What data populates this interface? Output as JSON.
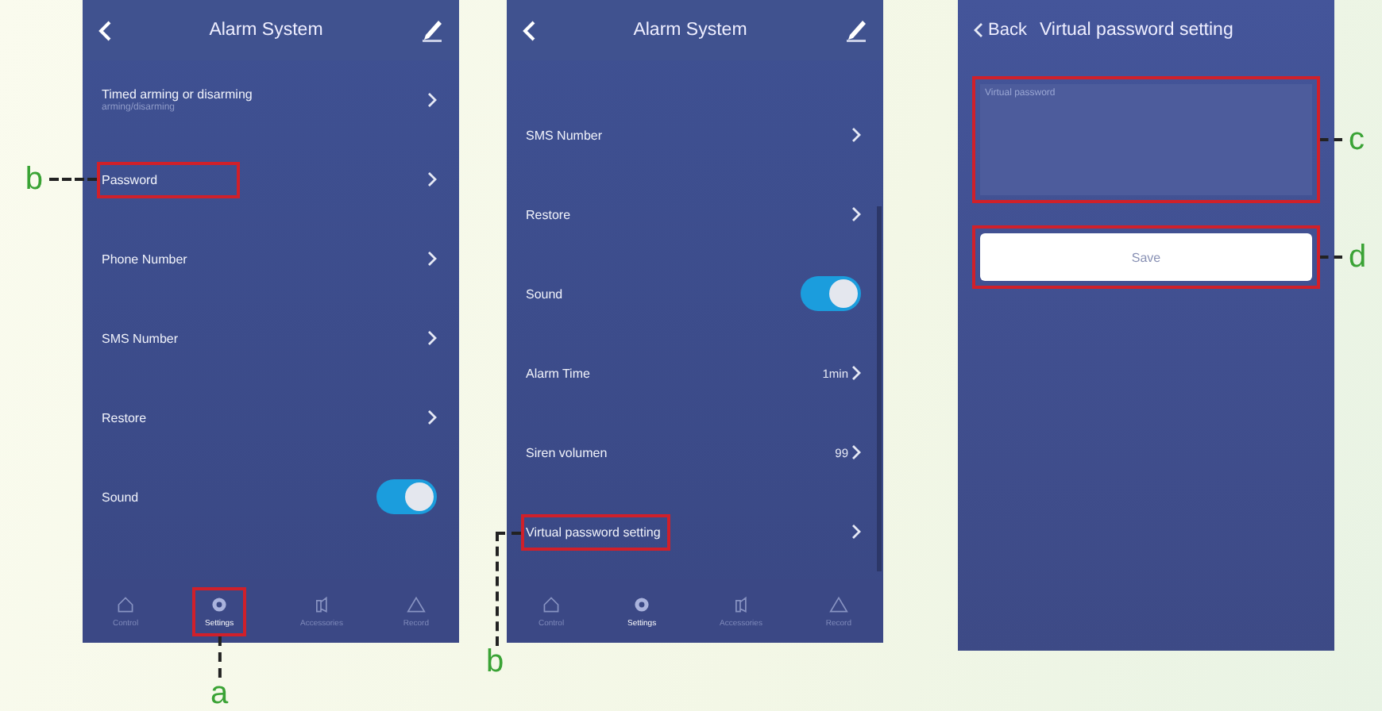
{
  "screens": [
    {
      "kind": "settings",
      "title": "Alarm System",
      "scrolled": false,
      "rows": [
        {
          "kind": "link",
          "label": "Timed arming or disarming",
          "sublabel": "arming/disarming"
        },
        {
          "kind": "link",
          "label": "Password",
          "callout": "b"
        },
        {
          "kind": "link",
          "label": "Phone Number"
        },
        {
          "kind": "link",
          "label": "SMS Number"
        },
        {
          "kind": "link",
          "label": "Restore"
        },
        {
          "kind": "toggle",
          "label": "Sound",
          "on": true
        }
      ],
      "tabs": [
        {
          "label": "Control",
          "selected": false
        },
        {
          "label": "Settings",
          "selected": true,
          "callout": "a"
        },
        {
          "label": "Accessories",
          "selected": false
        },
        {
          "label": "Record",
          "selected": false
        }
      ]
    },
    {
      "kind": "settings",
      "title": "Alarm System",
      "scrolled": true,
      "rows": [
        {
          "kind": "link",
          "label": "SMS Number"
        },
        {
          "kind": "link",
          "label": "Restore"
        },
        {
          "kind": "toggle",
          "label": "Sound",
          "on": true
        },
        {
          "kind": "link",
          "label": "Alarm Time",
          "value": "1min"
        },
        {
          "kind": "link",
          "label": "Siren volumen",
          "value": "99"
        },
        {
          "kind": "link",
          "label": "Virtual password setting",
          "callout": "b"
        }
      ],
      "tabs": [
        {
          "label": "Control",
          "selected": false
        },
        {
          "label": "Settings",
          "selected": true
        },
        {
          "label": "Accessories",
          "selected": false
        },
        {
          "label": "Record",
          "selected": false
        }
      ]
    },
    {
      "kind": "form",
      "back": "Back",
      "title": "Virtual password setting",
      "field": {
        "placeholder": "Virtual password",
        "callout": "c"
      },
      "button": {
        "label": "Save",
        "callout": "d"
      }
    }
  ]
}
